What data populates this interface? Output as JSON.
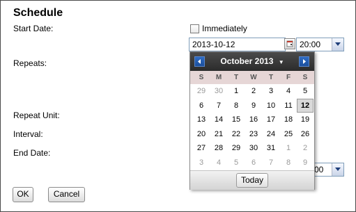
{
  "form": {
    "title": "Schedule",
    "start_date_label": "Start Date:",
    "repeats_label": "Repeats:",
    "repeat_unit_label": "Repeat Unit:",
    "interval_label": "Interval:",
    "end_date_label": "End Date:",
    "immediately_label": "Immediately",
    "immediately_checked": false,
    "start_date_value": "2013-10-12",
    "start_time_value": "20:00",
    "end_time_value": "00"
  },
  "buttons": {
    "ok": "OK",
    "cancel": "Cancel"
  },
  "calendar": {
    "month_label": "October 2013",
    "weekdays": [
      "S",
      "M",
      "T",
      "W",
      "T",
      "F",
      "S"
    ],
    "selected_day": "12",
    "today_label": "Today",
    "weeks": [
      [
        {
          "d": "29",
          "o": true
        },
        {
          "d": "30",
          "o": true
        },
        {
          "d": "1"
        },
        {
          "d": "2"
        },
        {
          "d": "3"
        },
        {
          "d": "4"
        },
        {
          "d": "5"
        }
      ],
      [
        {
          "d": "6"
        },
        {
          "d": "7"
        },
        {
          "d": "8"
        },
        {
          "d": "9"
        },
        {
          "d": "10"
        },
        {
          "d": "11"
        },
        {
          "d": "12",
          "s": true
        }
      ],
      [
        {
          "d": "13"
        },
        {
          "d": "14"
        },
        {
          "d": "15"
        },
        {
          "d": "16"
        },
        {
          "d": "17"
        },
        {
          "d": "18"
        },
        {
          "d": "19"
        }
      ],
      [
        {
          "d": "20"
        },
        {
          "d": "21"
        },
        {
          "d": "22"
        },
        {
          "d": "23"
        },
        {
          "d": "24"
        },
        {
          "d": "25"
        },
        {
          "d": "26"
        }
      ],
      [
        {
          "d": "27"
        },
        {
          "d": "28"
        },
        {
          "d": "29"
        },
        {
          "d": "30"
        },
        {
          "d": "31"
        },
        {
          "d": "1",
          "o": true
        },
        {
          "d": "2",
          "o": true
        }
      ],
      [
        {
          "d": "3",
          "o": true
        },
        {
          "d": "4",
          "o": true
        },
        {
          "d": "5",
          "o": true
        },
        {
          "d": "6",
          "o": true
        },
        {
          "d": "7",
          "o": true
        },
        {
          "d": "8",
          "o": true
        },
        {
          "d": "9",
          "o": true
        }
      ]
    ]
  }
}
